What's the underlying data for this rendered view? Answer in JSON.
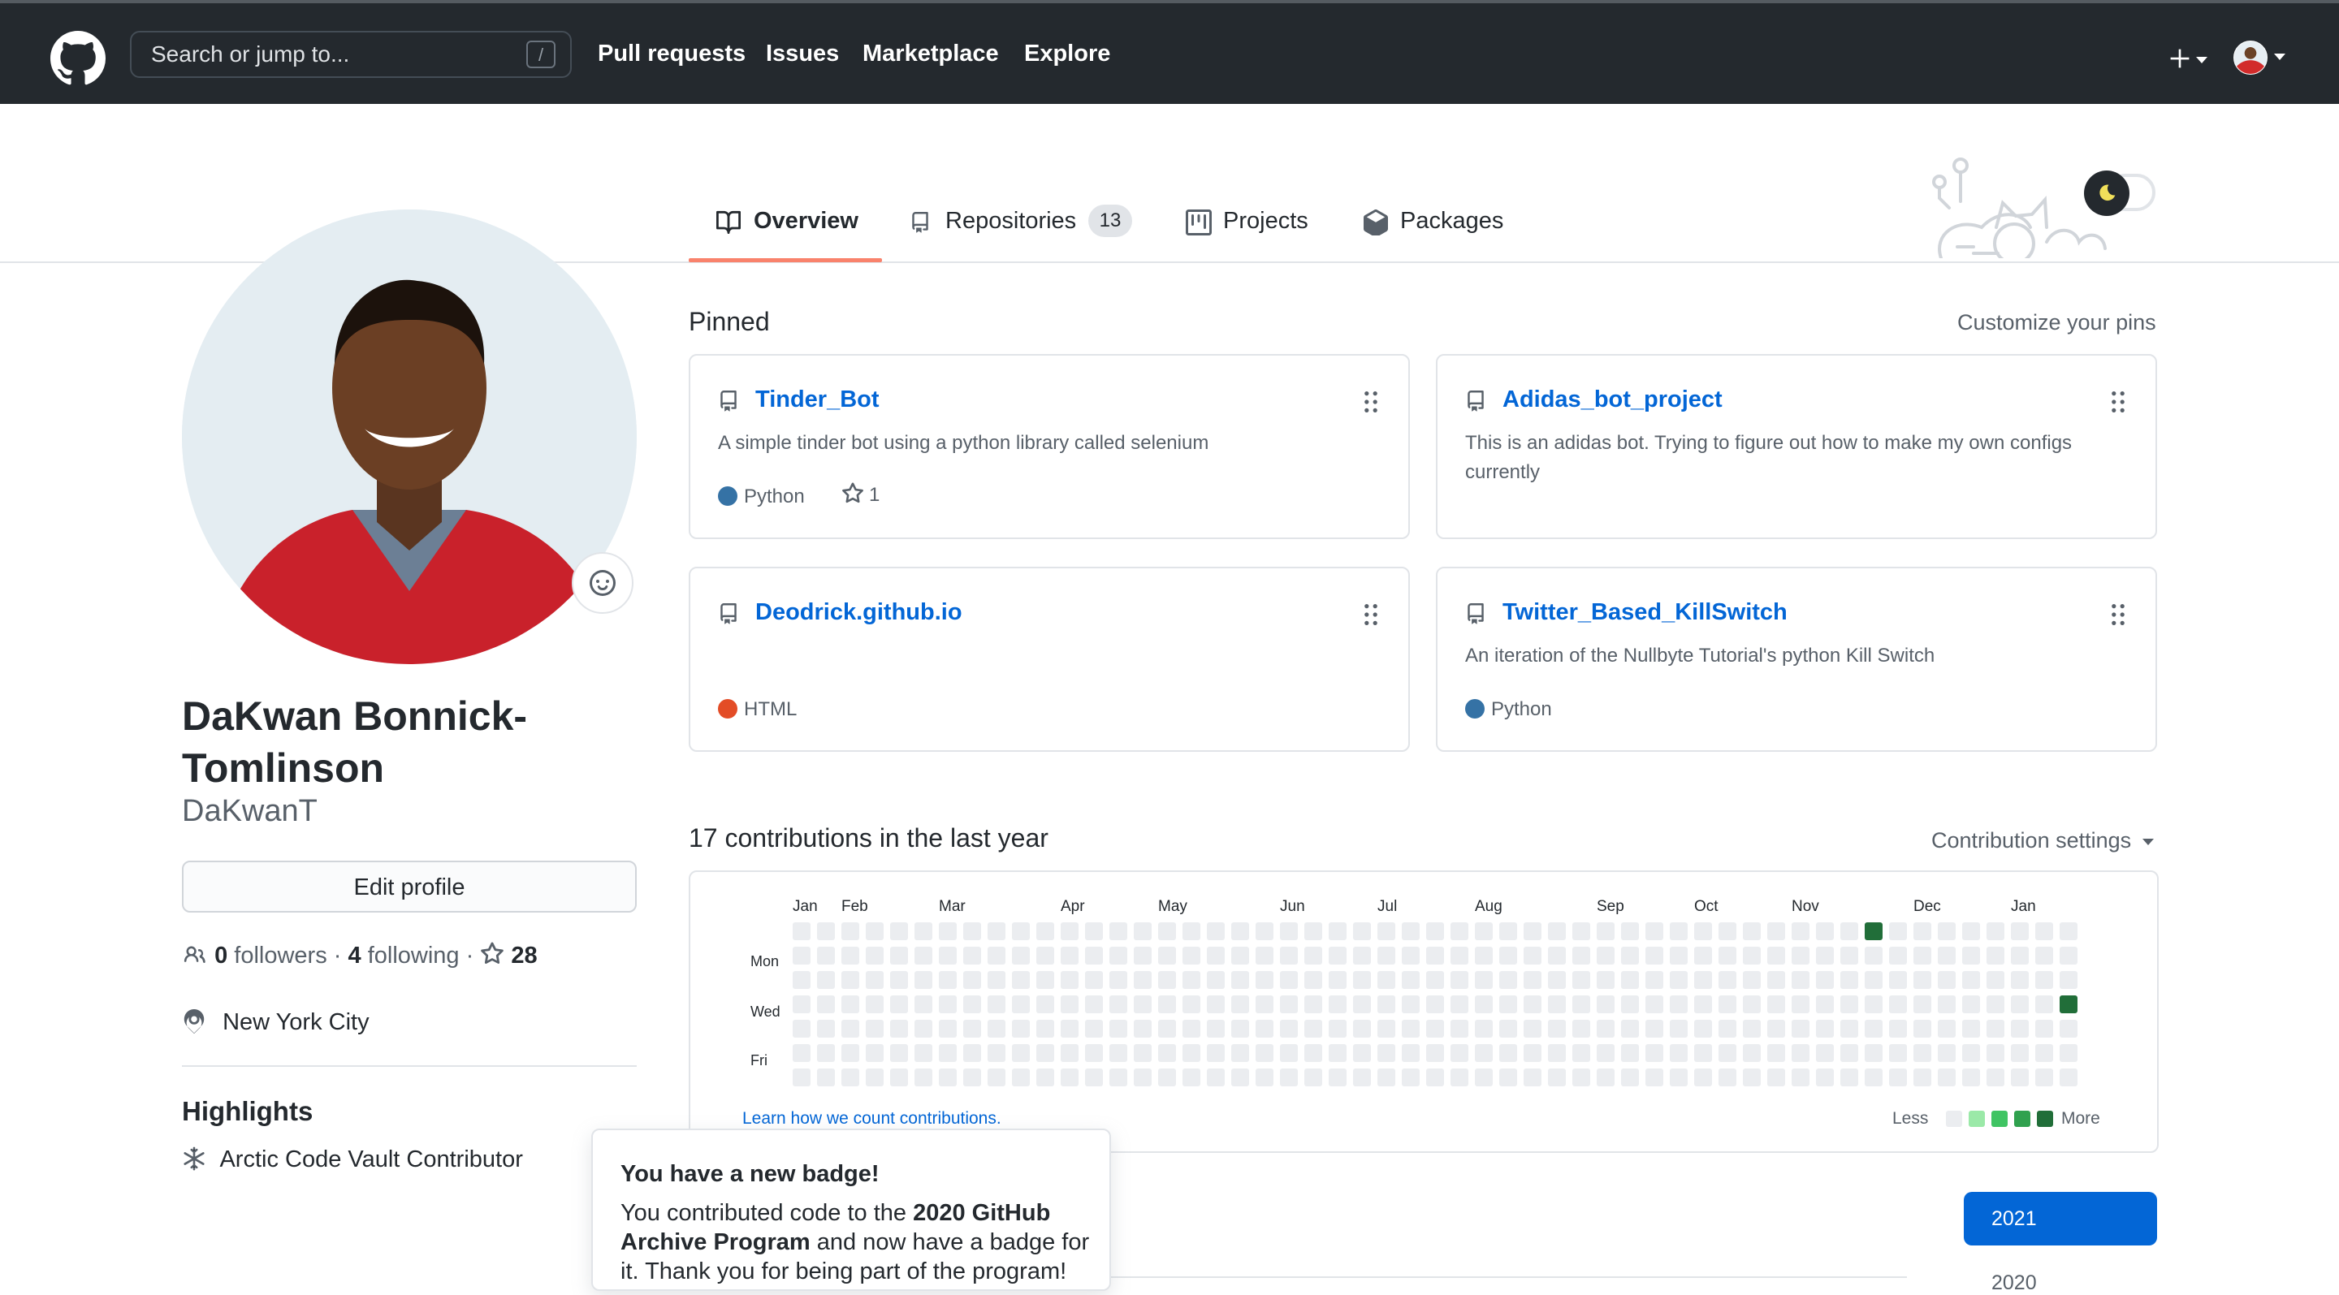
{
  "header": {
    "search_placeholder": "Search or jump to...",
    "search_key": "/",
    "nav": [
      "Pull requests",
      "Issues",
      "Marketplace",
      "Explore"
    ]
  },
  "tabs": [
    {
      "label": "Overview",
      "active": true
    },
    {
      "label": "Repositories",
      "count": "13"
    },
    {
      "label": "Projects"
    },
    {
      "label": "Packages"
    }
  ],
  "profile": {
    "full_name": "DaKwan Bonnick-Tomlinson",
    "username": "DaKwanT",
    "edit_label": "Edit profile",
    "followers_count": "0",
    "followers_label": "followers",
    "following_count": "4",
    "following_label": "following",
    "stars_count": "28",
    "location": "New York City",
    "highlights_title": "Highlights",
    "highlight_item": "Arctic Code Vault Contributor"
  },
  "pinned": {
    "title": "Pinned",
    "customize": "Customize your pins",
    "repos": [
      {
        "name": "Tinder_Bot",
        "description": "A simple tinder bot using a python library called selenium",
        "language": "Python",
        "lang_color": "#3572a5",
        "stars": "1"
      },
      {
        "name": "Adidas_bot_project",
        "description": "This is an adidas bot. Trying to figure out how to make my own configs currently",
        "language": "",
        "lang_color": "",
        "stars": ""
      },
      {
        "name": "Deodrick.github.io",
        "description": "",
        "language": "HTML",
        "lang_color": "#e34c26",
        "stars": ""
      },
      {
        "name": "Twitter_Based_KillSwitch",
        "description": "An iteration of the Nullbyte Tutorial's python Kill Switch",
        "language": "Python",
        "lang_color": "#3572a5",
        "stars": ""
      }
    ]
  },
  "contributions": {
    "title": "17 contributions in the last year",
    "settings": "Contribution settings",
    "months": [
      "Jan",
      "Feb",
      "Mar",
      "Apr",
      "May",
      "Jun",
      "Jul",
      "Aug",
      "Sep",
      "Oct",
      "Nov",
      "Dec",
      "Jan"
    ],
    "month_weeks": [
      0,
      2,
      6,
      11,
      15,
      20,
      24,
      28,
      33,
      37,
      41,
      46,
      50
    ],
    "days": [
      "Mon",
      "Wed",
      "Fri"
    ],
    "weeks": 53,
    "active": [
      {
        "week": 44,
        "day": 0,
        "level": 4
      },
      {
        "week": 52,
        "day": 3,
        "level": 4
      }
    ],
    "learn": "Learn how we count contributions.",
    "less": "Less",
    "more": "More",
    "level_colors": [
      "#ebedf0",
      "#9be9a8",
      "#40c463",
      "#30a14e",
      "#216e39"
    ]
  },
  "years": {
    "current": "2021",
    "next": "2020"
  },
  "badge_popup": {
    "title": "You have a new badge!",
    "text_before": "You contributed code to the ",
    "text_bold": "2020 GitHub Archive Program",
    "text_after": " and now have a badge for it. Thank you for being part of the program!"
  }
}
